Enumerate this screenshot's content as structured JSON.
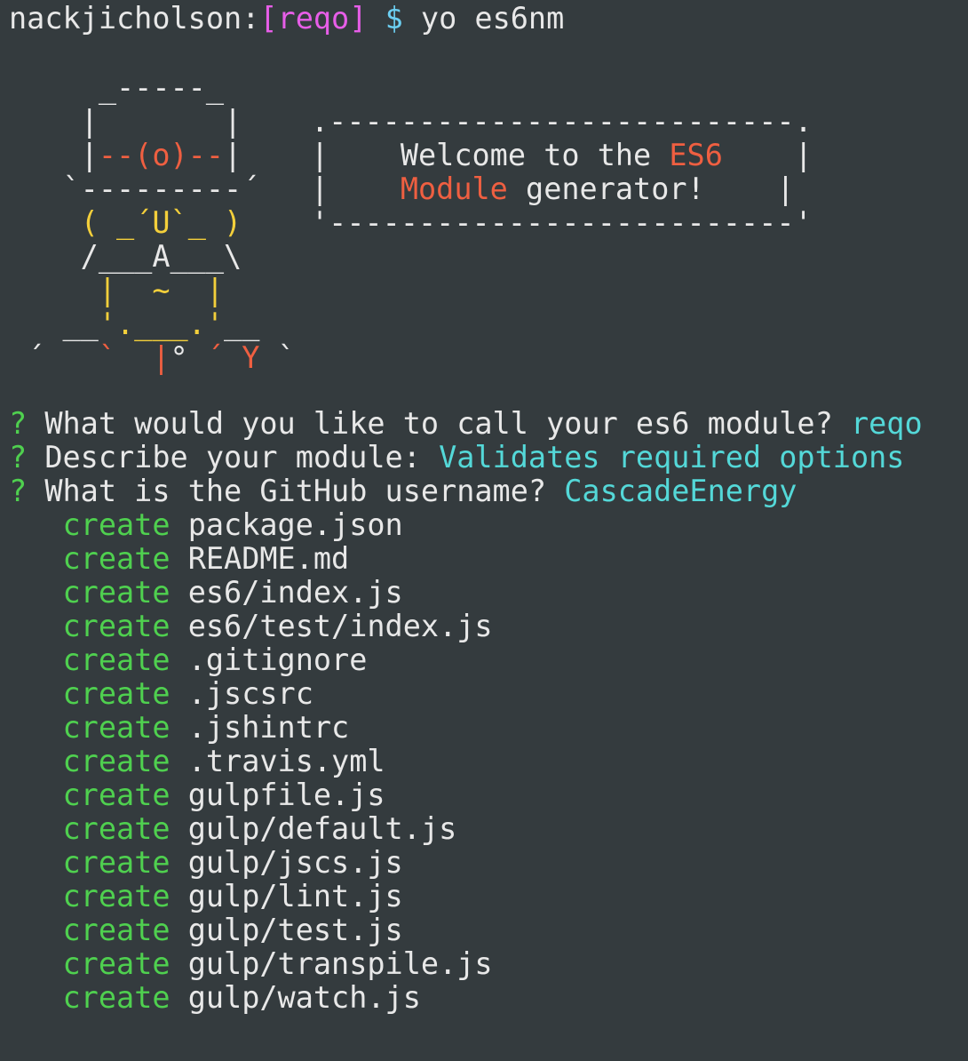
{
  "prompt": {
    "user": "nackjicholson",
    "colon": ":",
    "branch": "[reqo]",
    "dollar": "$",
    "command": "yo es6nm"
  },
  "yeoman_art": {
    "lines": [
      {
        "segments": [
          {
            "text": "     _-----_",
            "color": "white"
          }
        ]
      },
      {
        "segments": [
          {
            "text": "    |       |",
            "color": "white"
          }
        ]
      },
      {
        "segments": [
          {
            "text": "    |",
            "color": "white"
          },
          {
            "text": "--(o)--",
            "color": "red"
          },
          {
            "text": "|",
            "color": "white"
          }
        ]
      },
      {
        "segments": [
          {
            "text": "   `---------´",
            "color": "white"
          }
        ]
      },
      {
        "segments": [
          {
            "text": "    ",
            "color": "white"
          },
          {
            "text": "( ",
            "color": "yellow"
          },
          {
            "text": "_",
            "color": "yellow"
          },
          {
            "text": "´U`",
            "color": "yellow"
          },
          {
            "text": "_ )",
            "color": "yellow"
          }
        ]
      },
      {
        "segments": [
          {
            "text": "    /___A___\\",
            "color": "white"
          }
        ]
      },
      {
        "segments": [
          {
            "text": "     ",
            "color": "white"
          },
          {
            "text": "|  ~  |",
            "color": "yellow"
          }
        ]
      },
      {
        "segments": [
          {
            "text": "   __",
            "color": "white"
          },
          {
            "text": "'.___.'",
            "color": "yellow"
          },
          {
            "text": "__",
            "color": "white"
          }
        ]
      },
      {
        "segments": [
          {
            "text": " ´   ",
            "color": "white"
          },
          {
            "text": "`  |",
            "color": "red"
          },
          {
            "text": "° ",
            "color": "white"
          },
          {
            "text": "´ Y",
            "color": "red"
          },
          {
            "text": " `",
            "color": "white"
          }
        ]
      }
    ]
  },
  "welcome_box": {
    "lines": [
      {
        "segments": [
          {
            "text": ".--------------------------.",
            "color": "white"
          }
        ]
      },
      {
        "segments": [
          {
            "text": "|    Welcome to the ",
            "color": "white"
          },
          {
            "text": "ES6",
            "color": "red"
          },
          {
            "text": "    |",
            "color": "white"
          }
        ]
      },
      {
        "segments": [
          {
            "text": "|    ",
            "color": "white"
          },
          {
            "text": "Module",
            "color": "red"
          },
          {
            "text": " generator!    |",
            "color": "white"
          }
        ]
      },
      {
        "segments": [
          {
            "text": "'--------------------------'",
            "color": "white"
          }
        ]
      }
    ]
  },
  "questions": [
    {
      "marker": "?",
      "question": "What would you like to call your es6 module?",
      "answer": "reqo"
    },
    {
      "marker": "?",
      "question": "Describe your module:",
      "answer": "Validates required options"
    },
    {
      "marker": "?",
      "question": "What is the GitHub username?",
      "answer": "CascadeEnergy"
    }
  ],
  "created_files": {
    "action_label": "create",
    "files": [
      "package.json",
      "README.md",
      "es6/index.js",
      "es6/test/index.js",
      ".gitignore",
      ".jscsrc",
      ".jshintrc",
      ".travis.yml",
      "gulpfile.js",
      "gulp/default.js",
      "gulp/jscs.js",
      "gulp/lint.js",
      "gulp/test.js",
      "gulp/transpile.js",
      "gulp/watch.js"
    ]
  },
  "colors": {
    "background": "#343b3e",
    "text": "#e8e8e8",
    "branch": "#e75ee8",
    "dollar": "#6ccff2",
    "accent_red": "#ef5f41",
    "accent_yellow": "#f3cf3b",
    "question_marker": "#4fd04f",
    "answer": "#54d8d8",
    "create_label": "#4fd04f"
  }
}
